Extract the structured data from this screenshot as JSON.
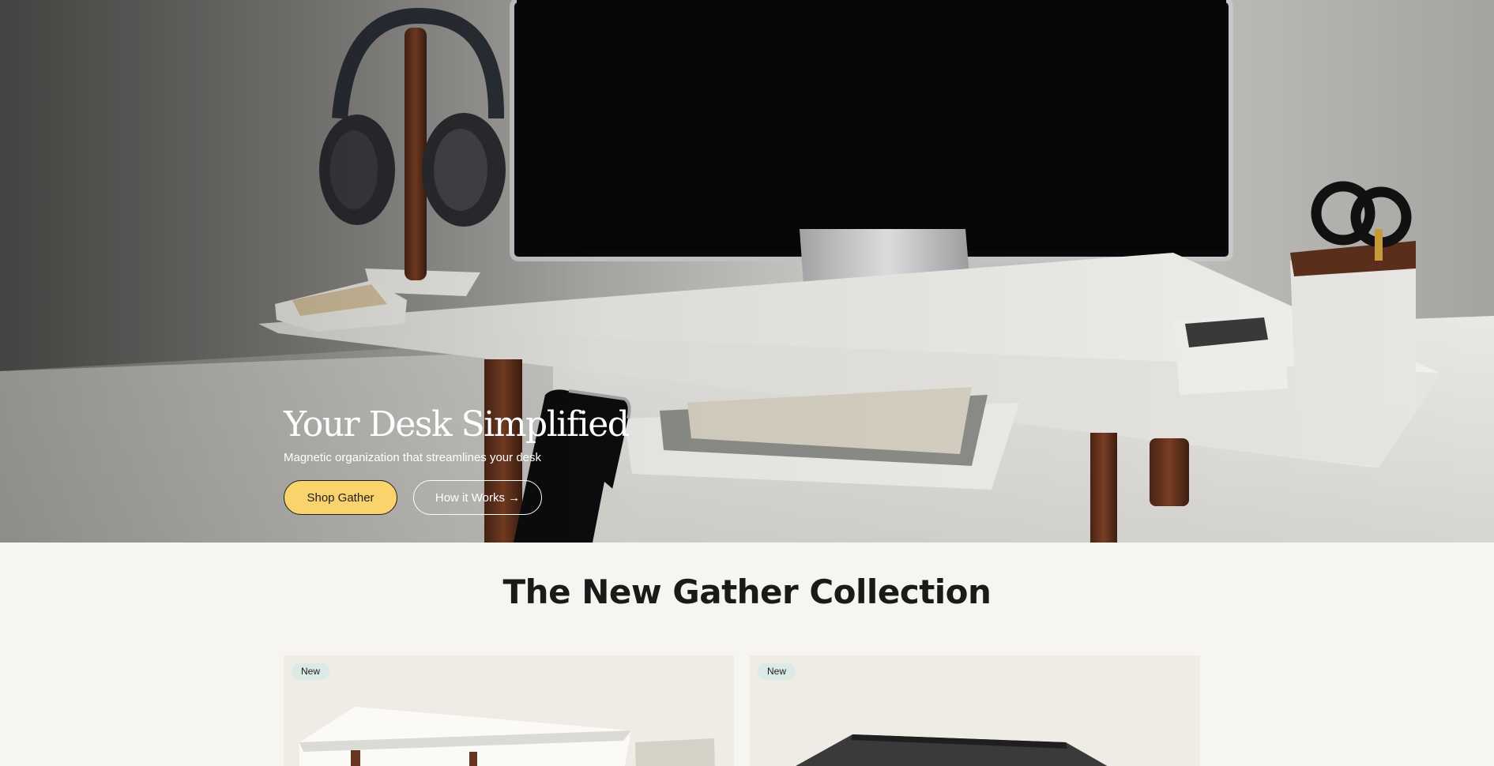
{
  "hero": {
    "title": "Your Desk Simplified",
    "subtitle": "Magnetic organization that streamlines your desk",
    "primary_button": "Shop Gather",
    "secondary_button": "How it Works →"
  },
  "collection": {
    "title": "The New Gather Collection",
    "cards": [
      {
        "badge": "New"
      },
      {
        "badge": "New"
      }
    ]
  },
  "colors": {
    "accent_button": "#fbd36c",
    "badge_bg": "#dbeae4",
    "page_bg": "#f7f5f0",
    "card_bg": "#efece6"
  },
  "icons": [
    "headphones-stand-illustration",
    "monitor-illustration",
    "phone-illustration",
    "pen-cup-illustration"
  ]
}
